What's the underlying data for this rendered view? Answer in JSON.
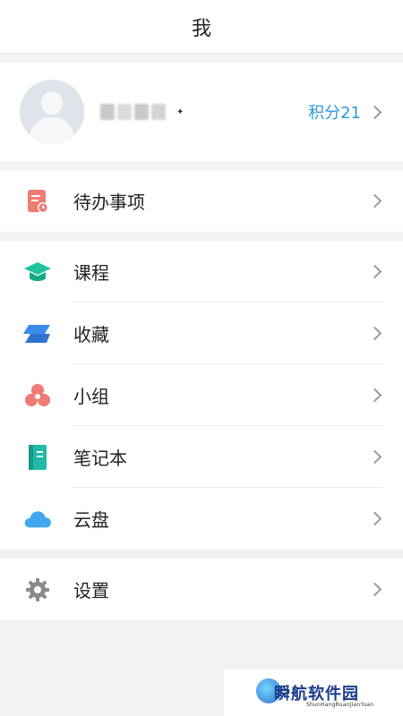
{
  "header": {
    "title": "我"
  },
  "profile": {
    "points_label": "积分21"
  },
  "menu_todo": [
    {
      "label": "待办事项",
      "icon": "todo-calendar-icon",
      "color": "#ef7b73"
    }
  ],
  "menu_main": [
    {
      "label": "课程",
      "icon": "graduation-cap-icon",
      "color": "#1fc3a0"
    },
    {
      "label": "收藏",
      "icon": "bookmark-layers-icon",
      "color": "#3b8be8"
    },
    {
      "label": "小组",
      "icon": "group-circles-icon",
      "color": "#ef7b73"
    },
    {
      "label": "笔记本",
      "icon": "notebook-icon",
      "color": "#22b9a6"
    },
    {
      "label": "云盘",
      "icon": "cloud-icon",
      "color": "#3fa8ef"
    }
  ],
  "menu_settings": [
    {
      "label": "设置",
      "icon": "gear-icon",
      "color": "#8a8a8e"
    }
  ],
  "watermark": {
    "text": "瞬航软件园",
    "sub": "ShunHangRuanJianYuan"
  }
}
